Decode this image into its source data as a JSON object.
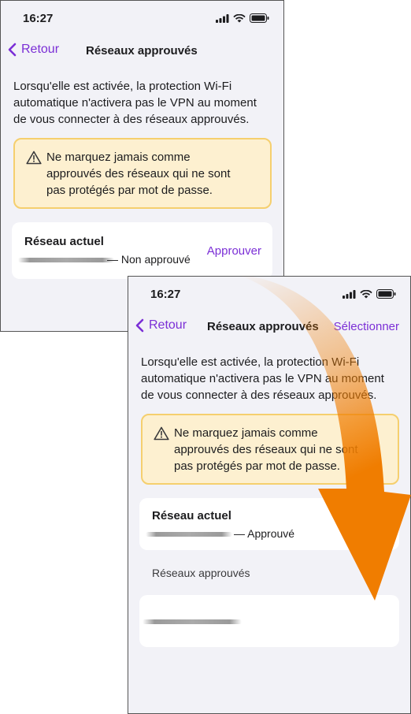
{
  "before": {
    "status": {
      "time": "16:27"
    },
    "nav": {
      "back_label": "Retour",
      "title": "Réseaux approuvés"
    },
    "description": [
      "Lorsqu'elle est activée, la protection Wi-Fi",
      "automatique n'activera pas le VPN au moment",
      "de vous connecter à des réseaux approuvés."
    ],
    "warning": [
      "Ne marquez jamais comme",
      "approuvés des réseaux qui ne sont",
      "pas protégés par mot de passe."
    ],
    "current_network": {
      "title": "Réseau actuel",
      "status": "— Non approuvé",
      "action": "Approuver"
    }
  },
  "after": {
    "status": {
      "time": "16:27"
    },
    "nav": {
      "back_label": "Retour",
      "title": "Réseaux approuvés",
      "action": "Sélectionner"
    },
    "description": [
      "Lorsqu'elle est activée, la protection Wi-Fi",
      "automatique n'activera pas le VPN au moment",
      "de vous connecter à des réseaux approuvés."
    ],
    "warning": [
      "Ne marquez jamais comme",
      "approuvés des réseaux qui ne sont",
      "pas protégés par mot de passe."
    ],
    "current_network": {
      "title": "Réseau actuel",
      "status": "— Approuvé"
    },
    "approved_section_label": "Réseaux approuvés"
  },
  "colors": {
    "accent": "#7b2fd6",
    "warning_bg": "#fdf0d0",
    "warning_border": "#f5cf6e",
    "arrow": "#f07d00"
  }
}
